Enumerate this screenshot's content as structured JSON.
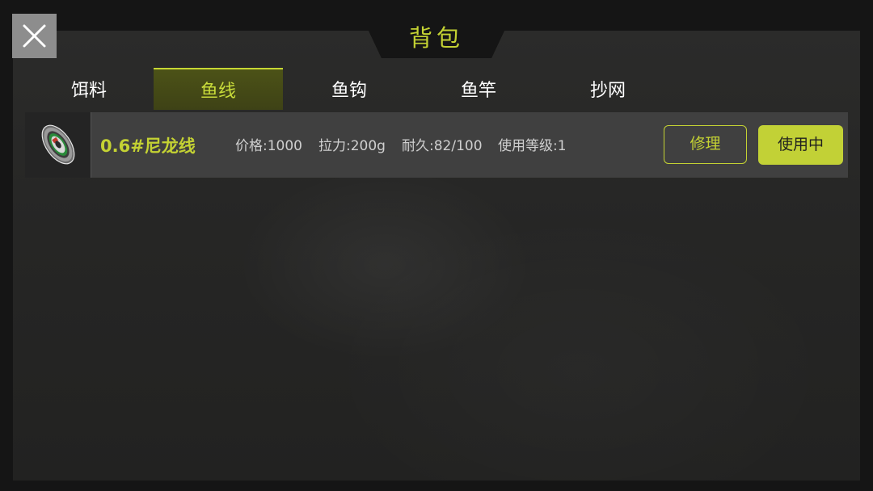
{
  "header": {
    "title": "背包"
  },
  "close_button": {
    "icon": "close-icon"
  },
  "tabs": [
    {
      "label": "饵料",
      "active": false
    },
    {
      "label": "鱼线",
      "active": true
    },
    {
      "label": "鱼钩",
      "active": false
    },
    {
      "label": "鱼竿",
      "active": false
    },
    {
      "label": "抄网",
      "active": false
    }
  ],
  "items": [
    {
      "icon": "fishing-line-spool-icon",
      "name": "0.6#尼龙线",
      "price": "价格:1000",
      "tension": "拉力:200g",
      "durability": "耐久:82/100",
      "level": "使用等级:1",
      "repair_label": "修理",
      "status_label": "使用中"
    }
  ],
  "colors": {
    "accent": "#c4d233",
    "panel": "#262625",
    "row": "#404040"
  }
}
